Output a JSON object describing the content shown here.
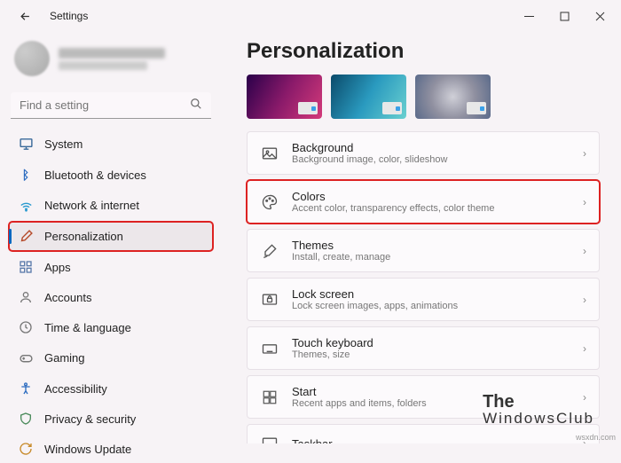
{
  "window": {
    "title": "Settings"
  },
  "user": {
    "name": "████████",
    "email": "██████████"
  },
  "search": {
    "placeholder": "Find a setting"
  },
  "sidebar": {
    "items": [
      {
        "label": "System",
        "icon": "🖥️"
      },
      {
        "label": "Bluetooth & devices",
        "icon": "ᛒ"
      },
      {
        "label": "Network & internet",
        "icon": "wifi"
      },
      {
        "label": "Personalization",
        "icon": "🖌"
      },
      {
        "label": "Apps",
        "icon": "▦"
      },
      {
        "label": "Accounts",
        "icon": "👤"
      },
      {
        "label": "Time & language",
        "icon": "🕒"
      },
      {
        "label": "Gaming",
        "icon": "🎮"
      },
      {
        "label": "Accessibility",
        "icon": "✳"
      },
      {
        "label": "Privacy & security",
        "icon": "🛡"
      },
      {
        "label": "Windows Update",
        "icon": "↻"
      }
    ]
  },
  "main": {
    "heading": "Personalization",
    "cards": [
      {
        "title": "Background",
        "subtitle": "Background image, color, slideshow"
      },
      {
        "title": "Colors",
        "subtitle": "Accent color, transparency effects, color theme"
      },
      {
        "title": "Themes",
        "subtitle": "Install, create, manage"
      },
      {
        "title": "Lock screen",
        "subtitle": "Lock screen images, apps, animations"
      },
      {
        "title": "Touch keyboard",
        "subtitle": "Themes, size"
      },
      {
        "title": "Start",
        "subtitle": "Recent apps and items, folders"
      },
      {
        "title": "Taskbar",
        "subtitle": ""
      }
    ]
  },
  "watermark": {
    "line1": "The",
    "line2": "WindowsClub",
    "corner": "wsxdn.com"
  }
}
